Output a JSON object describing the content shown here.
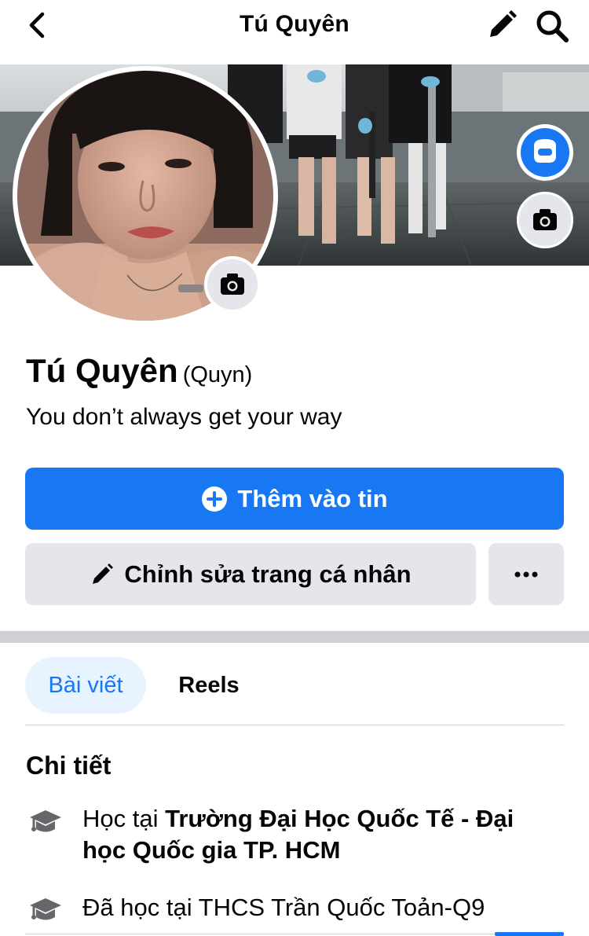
{
  "header": {
    "title": "Tú Quyên"
  },
  "profile": {
    "name": "Tú Quyên",
    "alternate_name": "(Quyn)",
    "bio": "You don’t always get your way"
  },
  "actions": {
    "add_story": "Thêm vào tin",
    "edit_profile": "Chỉnh sửa trang cá nhân",
    "more": "···"
  },
  "tabs": [
    {
      "label": "Bài viết",
      "active": true
    },
    {
      "label": "Reels",
      "active": false
    }
  ],
  "details": {
    "title": "Chi tiết",
    "items": [
      {
        "prefix": "Học tại ",
        "bold": "Trường Đại Học Quốc Tế - Đại học Quốc gia TP. HCM",
        "icon": "graduation-cap-icon"
      },
      {
        "prefix": "Đã học tại THCS Trần Quốc Toản-Q9",
        "bold": "",
        "icon": "graduation-cap-icon"
      }
    ]
  },
  "colors": {
    "accent": "#1877f2",
    "button_gray": "#e4e6eb",
    "tab_active_bg": "#e7f3ff",
    "divider": "#ced0d4"
  }
}
